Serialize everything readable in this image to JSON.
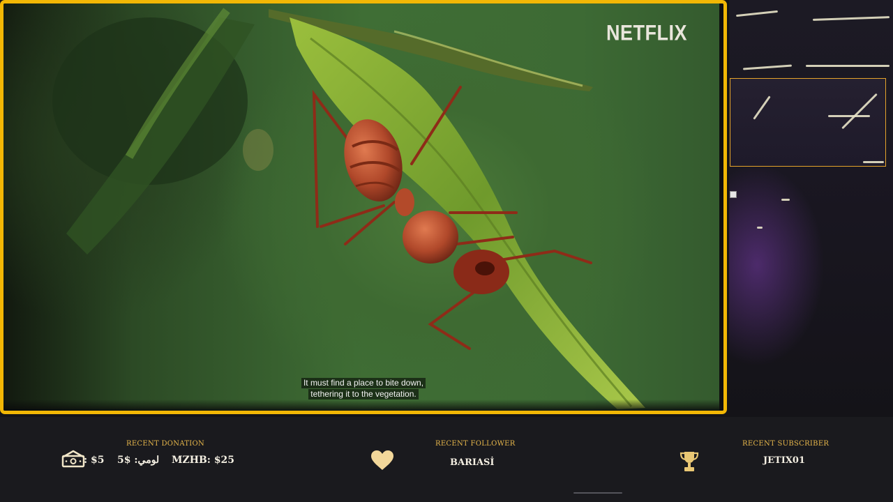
{
  "video": {
    "watermark": "NETFLIX",
    "subtitle_lines": [
      "It must find a place to bite down,",
      "tethering it to the vegetation."
    ]
  },
  "stream_overlay": {
    "recent_donation": {
      "title": "RECENT DONATION",
      "items": [
        "$5",
        "لومي: $5",
        "MZHB: $25"
      ],
      "icon": "money-icon"
    },
    "recent_follower": {
      "title": "RECENT FOLLOWER",
      "value": "BARIASİ",
      "icon": "heart-icon"
    },
    "recent_subscriber": {
      "title": "RECENT SUBSCRIBER",
      "value": "JETIX01",
      "icon": "trophy-icon"
    }
  },
  "colors": {
    "frame_accent": "#f2b705",
    "label_gold": "#e7b74b",
    "background": "#141418"
  }
}
